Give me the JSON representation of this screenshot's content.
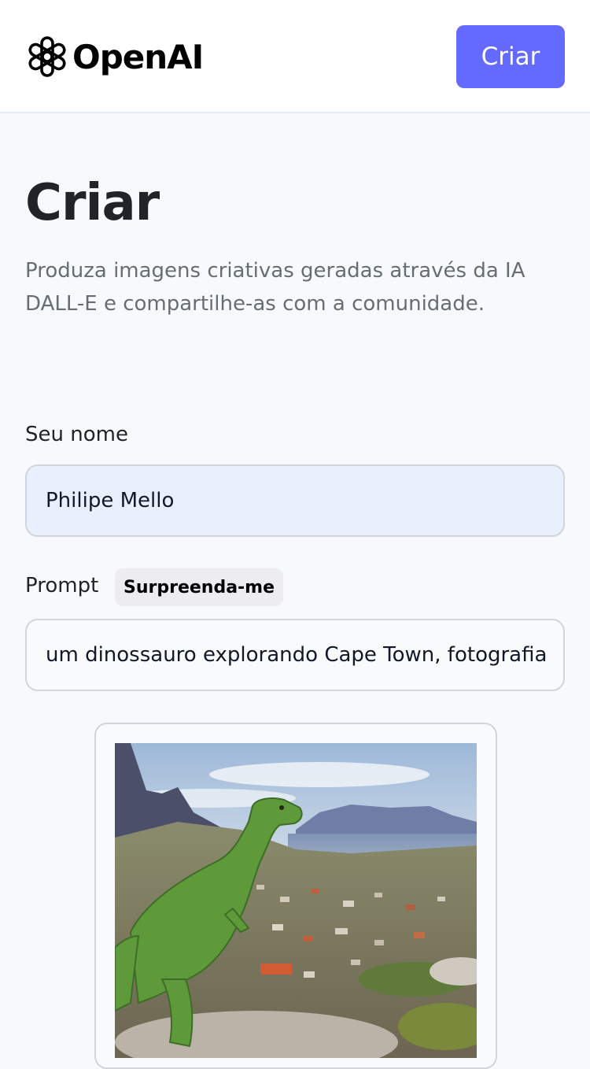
{
  "header": {
    "logo_text": "OpenAI",
    "logo_icon": "openai-knot-icon",
    "create_button_label": "Criar"
  },
  "main": {
    "title": "Criar",
    "subtitle": "Produza imagens criativas geradas através da IA DALL-E e compartilhe-as com a comunidade.",
    "name_field": {
      "label": "Seu nome",
      "value": "Philipe Mello"
    },
    "prompt_field": {
      "label": "Prompt",
      "surprise_button_label": "Surpreenda-me",
      "value": "um dinossauro explorando Cape Town, fotografia"
    },
    "generated_image": {
      "description_icon": "generated-image-dinosaur"
    }
  },
  "colors": {
    "accent": "#6469ff",
    "page_background": "#f8f9fc",
    "title_text": "#222328",
    "subtitle_text": "#666e75",
    "name_input_background": "#e8f0fd"
  }
}
